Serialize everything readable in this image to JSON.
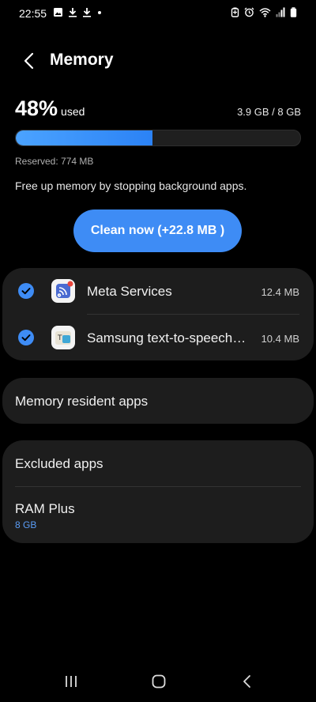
{
  "status_bar": {
    "time": "22:55",
    "left_icons": [
      "image-icon",
      "download-icon",
      "download-icon",
      "dot-icon"
    ],
    "right_icons": [
      "battery-saver-icon",
      "alarm-icon",
      "wifi-icon",
      "signal-icon",
      "battery-icon"
    ]
  },
  "header": {
    "back_icon": "chevron-left-icon",
    "title": "Memory"
  },
  "usage": {
    "percent": "48%",
    "percent_value": 48,
    "used_label": "used",
    "amount": "3.9 GB / 8 GB",
    "reserved": "Reserved: 774 MB"
  },
  "description": "Free up memory by stopping background apps.",
  "clean_button": {
    "label": "Clean now (+22.8 MB )"
  },
  "apps": [
    {
      "name": "Meta Services",
      "size": "12.4 MB",
      "checked": true,
      "icon": "meta-services-icon"
    },
    {
      "name": "Samsung text-to-speech…",
      "size": "10.4 MB",
      "checked": true,
      "icon": "samsung-tts-icon"
    }
  ],
  "menu": {
    "resident": "Memory resident apps",
    "excluded": "Excluded apps",
    "ram_plus": {
      "label": "RAM Plus",
      "value": "8 GB"
    }
  },
  "nav": {
    "recents_icon": "recents-icon",
    "home_icon": "home-icon",
    "back_icon": "back-icon"
  },
  "colors": {
    "accent": "#3e8cf5",
    "bar_fill": "#4ba3ff",
    "link": "#5a9cf5",
    "card": "#1d1d1d"
  }
}
